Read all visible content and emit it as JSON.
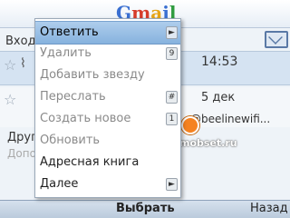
{
  "header": {
    "logo": [
      "G",
      "m",
      "a",
      "i",
      "l"
    ]
  },
  "inbox": {
    "label": "Вход"
  },
  "rows": {
    "first_time": "14:53",
    "second_date": "5 дек",
    "second_email": "@beelinewifi...",
    "other_label": "Друг",
    "extra_label": "Допо"
  },
  "watermark": "mobset.ru",
  "menu": {
    "items": [
      {
        "label": "Ответить",
        "key": "►"
      },
      {
        "label": "Удалить",
        "key": "9"
      },
      {
        "label": "Добавить звезду",
        "key": ""
      },
      {
        "label": "Переслать",
        "key": "#"
      },
      {
        "label": "Создать новое",
        "key": "1"
      },
      {
        "label": "Обновить",
        "key": ""
      },
      {
        "label": "Адресная книга",
        "key": ""
      },
      {
        "label": "Далее",
        "key": "►"
      }
    ]
  },
  "softkeys": {
    "select": "Выбрать",
    "back": "Назад"
  },
  "colors": {
    "selection": "#86b2de",
    "accent": "#f58220"
  }
}
